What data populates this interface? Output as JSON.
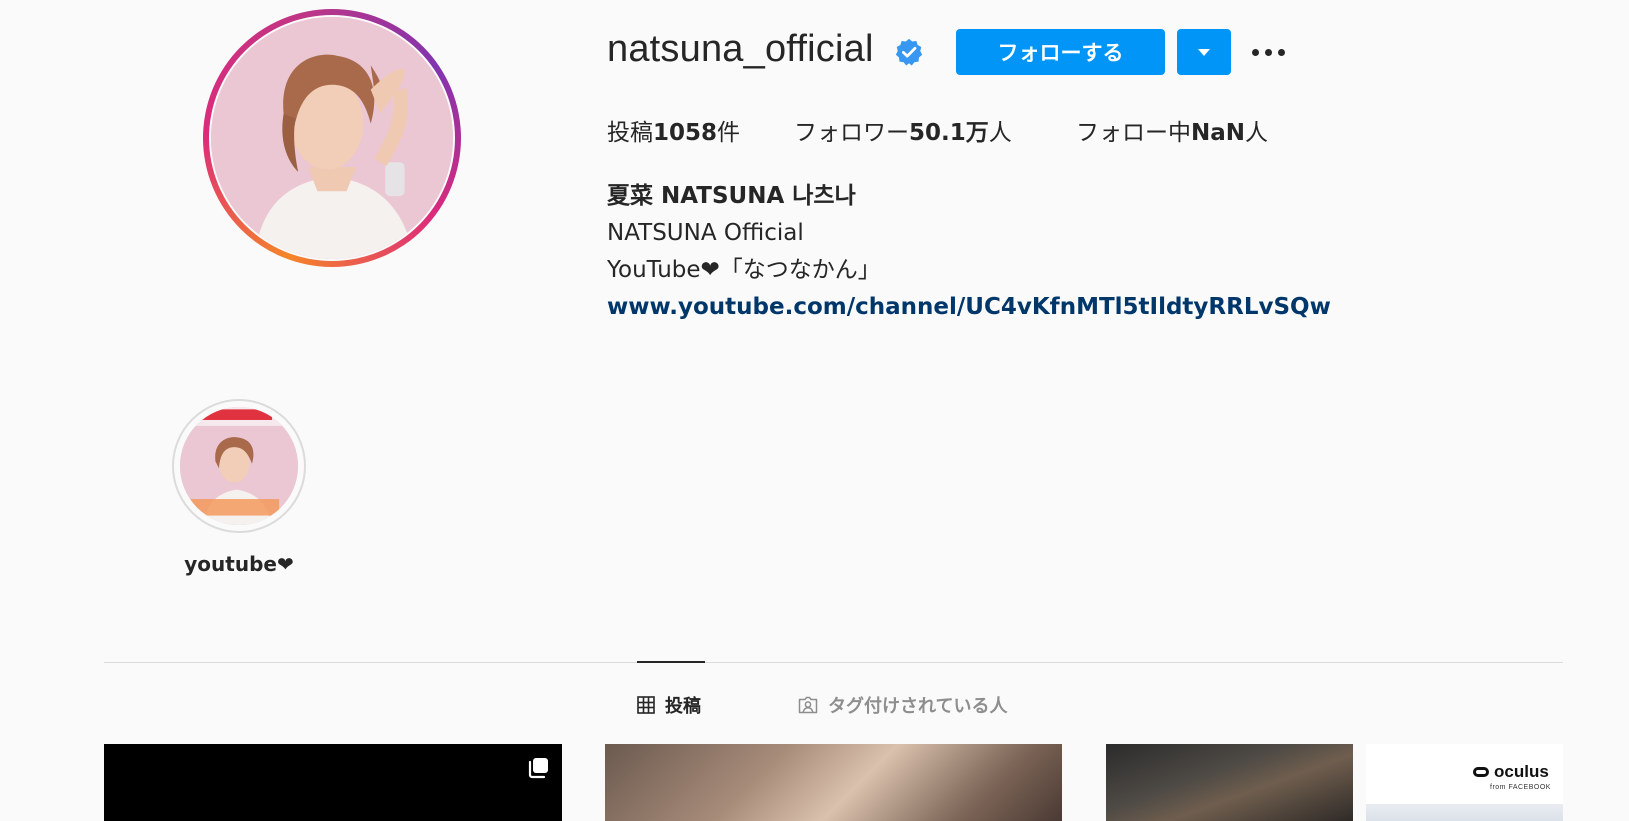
{
  "profile": {
    "username": "natsuna_official",
    "verified_icon": "verified-badge-icon",
    "follow_label": "フォローする",
    "dropdown_icon": "caret-down-icon",
    "more_icon": "more-options-icon",
    "accent_color": "#0095f6"
  },
  "stats": {
    "posts_prefix": "投稿",
    "posts_count": "1058",
    "posts_suffix": "件",
    "followers_prefix": "フォロワー",
    "followers_count": "50.1万",
    "followers_suffix": "人",
    "following_prefix": "フォロー中",
    "following_count": "NaN",
    "following_suffix": "人"
  },
  "bio": {
    "full_name": "夏菜 NATSUNA 나츠나",
    "line1": "NATSUNA Official",
    "line2": "YouTube❤︎「なつなかん」",
    "link": "www.youtube.com/channel/UC4vKfnMTl5tIldtyRRLvSQw",
    "link_color": "#00376b"
  },
  "highlights": [
    {
      "label": "youtube❤︎"
    }
  ],
  "tabs": [
    {
      "label": "投稿",
      "icon": "grid-icon",
      "active": true
    },
    {
      "label": "タグ付けされている人",
      "icon": "tagged-person-icon",
      "active": false
    }
  ],
  "grid": {
    "oculus_brand": "oculus",
    "oculus_sub": "from FACEBOOK"
  }
}
